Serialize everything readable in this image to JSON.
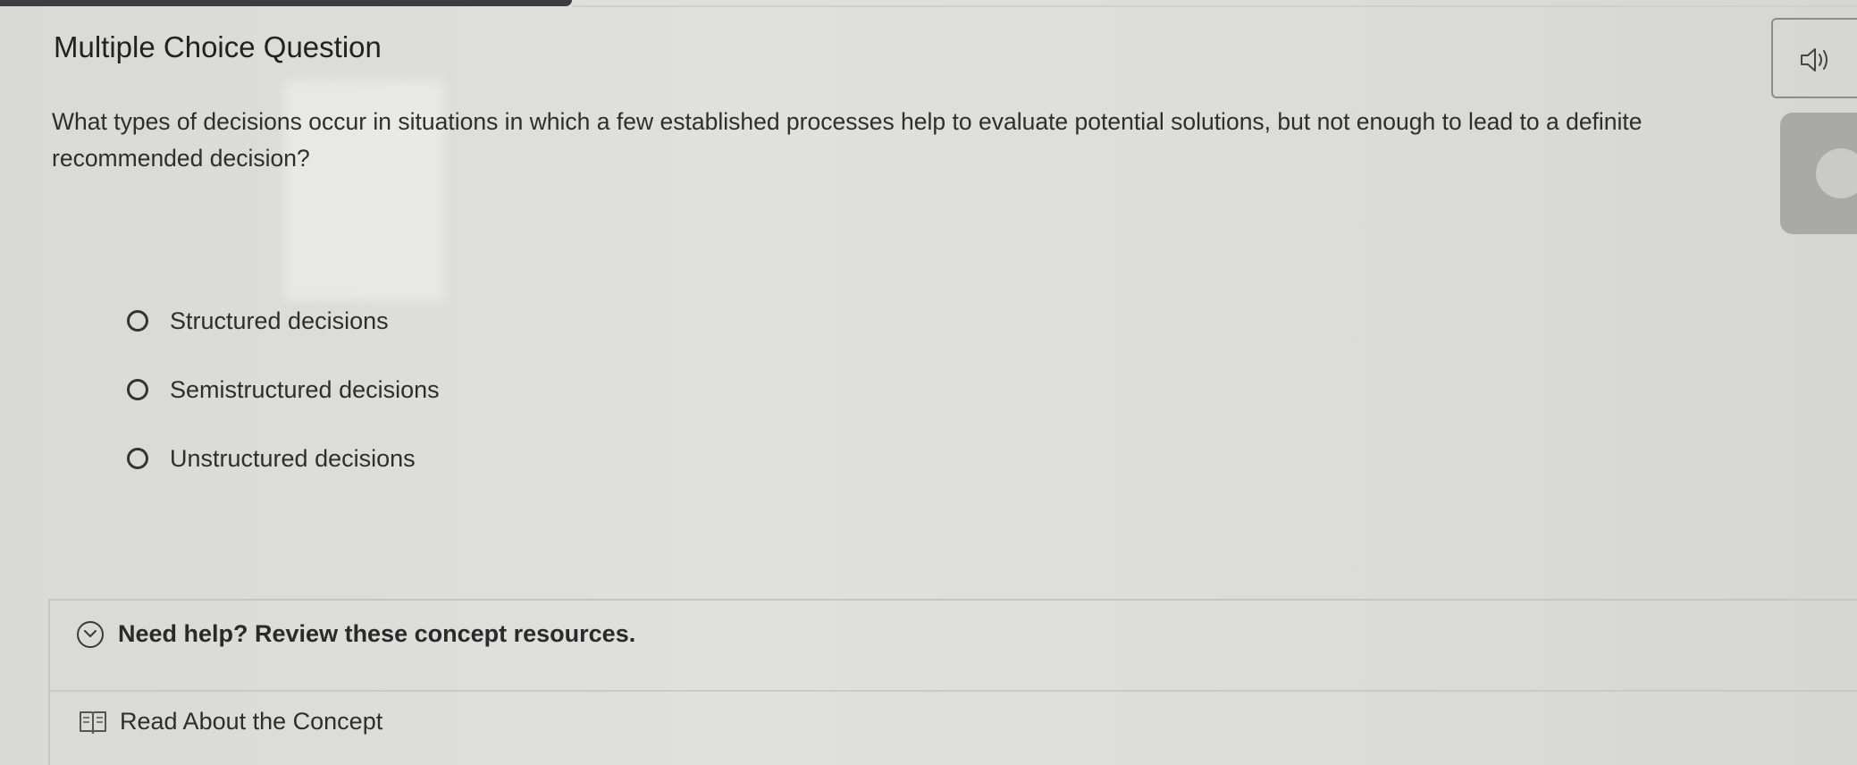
{
  "question": {
    "type_label": "Multiple Choice Question",
    "prompt": "What types of decisions occur in situations in which a few established processes help to evaluate potential solutions, but not enough to lead to a definite recommended decision?",
    "options": [
      {
        "label": "Structured decisions"
      },
      {
        "label": "Semistructured decisions"
      },
      {
        "label": "Unstructured decisions"
      }
    ]
  },
  "audio": {
    "icon": "speaker-icon"
  },
  "help": {
    "title": "Need help? Review these concept resources.",
    "icon": "chevron-down-circle-icon",
    "resources": [
      {
        "label": "Read About the Concept",
        "icon": "book-icon"
      }
    ]
  }
}
